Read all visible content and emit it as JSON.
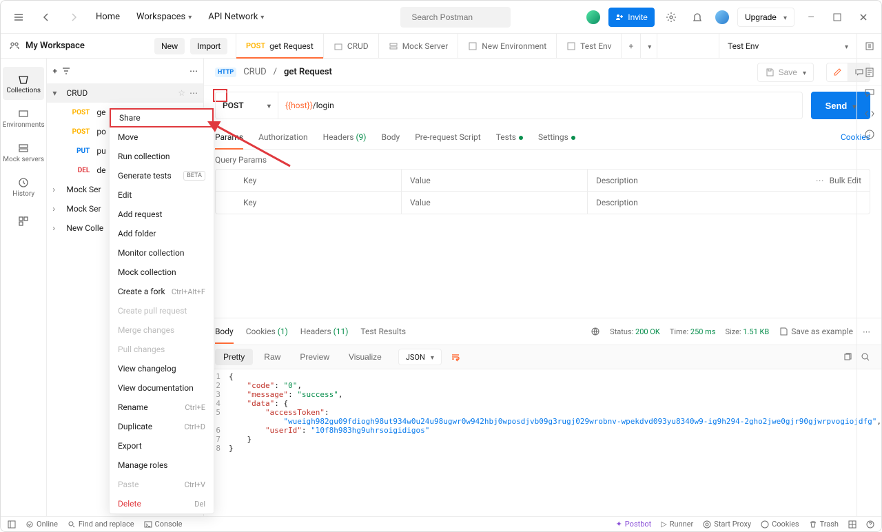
{
  "header": {
    "home": "Home",
    "workspaces": "Workspaces",
    "api_network": "API Network",
    "search_placeholder": "Search Postman",
    "invite": "Invite",
    "upgrade": "Upgrade"
  },
  "workspace": {
    "title": "My Workspace",
    "new": "New",
    "import": "Import"
  },
  "tabs": [
    {
      "method": "POST",
      "label": "get Request",
      "active": true,
      "icon": ""
    },
    {
      "label": "CRUD",
      "icon": "folder"
    },
    {
      "label": "Mock Server",
      "icon": "mock"
    },
    {
      "label": "New Environment",
      "icon": "env"
    },
    {
      "label": "Test Env",
      "icon": "env"
    }
  ],
  "environment": "Test Env",
  "left_sidebar": [
    {
      "label": "Collections",
      "active": true
    },
    {
      "label": "Environments"
    },
    {
      "label": "Mock servers"
    },
    {
      "label": "History"
    }
  ],
  "tree": {
    "collection": "CRUD",
    "requests": [
      {
        "method": "POST",
        "label": "ge"
      },
      {
        "method": "POST",
        "label": "po"
      },
      {
        "method": "PUT",
        "label": "pu"
      },
      {
        "method": "DEL",
        "label": "de"
      }
    ],
    "folders": [
      {
        "label": "Mock Ser"
      },
      {
        "label": "Mock Ser"
      },
      {
        "label": "New Colle"
      }
    ]
  },
  "context_menu": [
    {
      "label": "Share",
      "highlighted": true
    },
    {
      "label": "Move"
    },
    {
      "label": "Run collection"
    },
    {
      "label": "Generate tests",
      "badge": "BETA"
    },
    {
      "label": "Edit"
    },
    {
      "label": "Add request"
    },
    {
      "label": "Add folder"
    },
    {
      "label": "Monitor collection"
    },
    {
      "label": "Mock collection"
    },
    {
      "label": "Create a fork",
      "hint": "Ctrl+Alt+F"
    },
    {
      "label": "Create pull request",
      "disabled": true
    },
    {
      "label": "Merge changes",
      "disabled": true
    },
    {
      "label": "Pull changes",
      "disabled": true
    },
    {
      "label": "View changelog"
    },
    {
      "label": "View documentation"
    },
    {
      "label": "Rename",
      "hint": "Ctrl+E"
    },
    {
      "label": "Duplicate",
      "hint": "Ctrl+D"
    },
    {
      "label": "Export"
    },
    {
      "label": "Manage roles"
    },
    {
      "label": "Paste",
      "hint": "Ctrl+V",
      "disabled": true
    },
    {
      "label": "Delete",
      "hint": "Del",
      "delete": true
    }
  ],
  "breadcrumb": {
    "http": "HTTP",
    "collection": "CRUD",
    "request": "get Request",
    "save": "Save"
  },
  "request": {
    "method": "POST",
    "url_var": "{{host}}",
    "url_path": "/login",
    "send": "Send"
  },
  "request_tabs": {
    "items": [
      "Params",
      "Authorization",
      "Headers",
      "Body",
      "Pre-request Script",
      "Tests",
      "Settings"
    ],
    "headers_count": "(9)",
    "cookies": "Cookies"
  },
  "query_params_label": "Query Params",
  "params_table": {
    "headers": {
      "key": "Key",
      "value": "Value",
      "desc": "Description",
      "bulk": "Bulk Edit"
    },
    "placeholders": {
      "key": "Key",
      "value": "Value",
      "desc": "Description"
    }
  },
  "response_tabs": {
    "body": "Body",
    "cookies": "Cookies",
    "cookies_count": "(1)",
    "headers": "Headers",
    "headers_count": "(11)",
    "test_results": "Test Results"
  },
  "response_status": {
    "status_label": "Status:",
    "status_code": "200 OK",
    "time_label": "Time:",
    "time_value": "250 ms",
    "size_label": "Size:",
    "size_value": "1.51 KB",
    "save_example": "Save as example"
  },
  "response_toolbar": {
    "pretty": "Pretty",
    "raw": "Raw",
    "preview": "Preview",
    "visualize": "Visualize",
    "format": "JSON"
  },
  "response_body": {
    "l1": "{",
    "l2_key": "\"code\"",
    "l2_val": "\"0\"",
    "l3_key": "\"message\"",
    "l3_val": "\"success\"",
    "l4_key": "\"data\"",
    "l5_key": "\"accessToken\"",
    "l5_val": "\"wueigh982gu09fdiogh98ut934w0u24u98ugwr0w942hbj0wposdjvb09g3rugj029wrobnv-wpekdvd093yu8340w9-ig9h294-2gho2jwe0gjr90gjwrpvogiojdfg\"",
    "l6_key": "\"userId\"",
    "l6_val": "\"10f8h983hg9uhrsoigidigos\"",
    "l7": "}",
    "l8": "}"
  },
  "footer": {
    "online": "Online",
    "find": "Find and replace",
    "console": "Console",
    "postbot": "Postbot",
    "runner": "Runner",
    "start_proxy": "Start Proxy",
    "cookies": "Cookies",
    "trash": "Trash"
  }
}
